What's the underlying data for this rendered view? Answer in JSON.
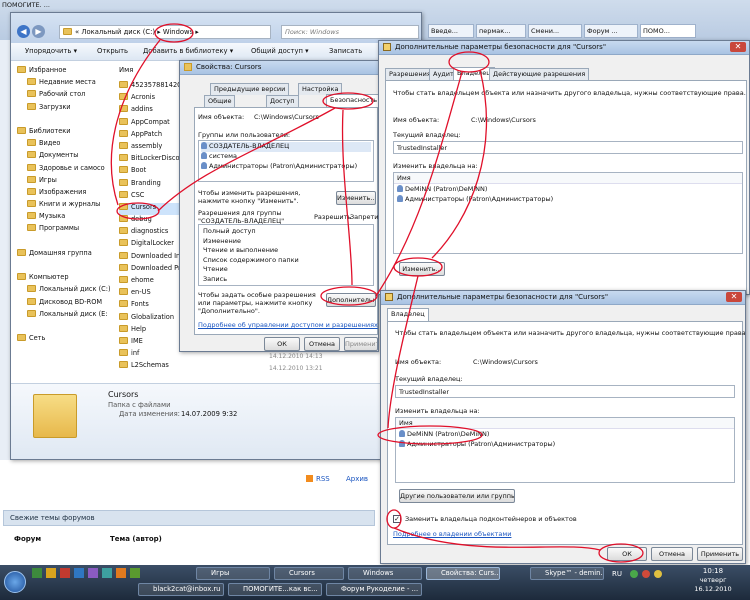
{
  "browser": {
    "tabs": [
      "ПОМОГИТЕ. ...",
      "Введе...",
      "пермак...",
      "Смени...",
      "Форум ...",
      "ПОМО..."
    ]
  },
  "explorer": {
    "address": [
      "Локальный диск (C:)",
      "Windows"
    ],
    "search_placeholder": "Поиск: Windows",
    "toolbar": [
      "Упорядочить ▾",
      "Открыть",
      "Добавить в библиотеку ▾",
      "Общий доступ ▾",
      "Записать"
    ],
    "nav": [
      {
        "label": "Избранное",
        "indent": 0
      },
      {
        "label": "Недавние места",
        "indent": 1
      },
      {
        "label": "Рабочий стол",
        "indent": 1
      },
      {
        "label": "Загрузки",
        "indent": 1
      },
      {
        "label": "",
        "indent": 0
      },
      {
        "label": "Библиотеки",
        "indent": 0
      },
      {
        "label": "Видео",
        "indent": 1
      },
      {
        "label": "Документы",
        "indent": 1
      },
      {
        "label": "Здоровье и самосо",
        "indent": 1
      },
      {
        "label": "Игры",
        "indent": 1
      },
      {
        "label": "Изображения",
        "indent": 1
      },
      {
        "label": "Книги и журналы",
        "indent": 1
      },
      {
        "label": "Музыка",
        "indent": 1
      },
      {
        "label": "Программы",
        "indent": 1
      },
      {
        "label": "",
        "indent": 0
      },
      {
        "label": "Домашняя группа",
        "indent": 0
      },
      {
        "label": "",
        "indent": 0
      },
      {
        "label": "Компьютер",
        "indent": 0
      },
      {
        "label": "Локальный диск (C:)",
        "indent": 1
      },
      {
        "label": "Дисковод BD-ROM",
        "indent": 1
      },
      {
        "label": "Локальный диск (E:",
        "indent": 1
      },
      {
        "label": "",
        "indent": 0
      },
      {
        "label": "Сеть",
        "indent": 0
      }
    ],
    "column_name": "Имя",
    "files": [
      "45235788142C4",
      "Acronis",
      "addins",
      "AppCompat",
      "AppPatch",
      "assembly",
      "BitLockerDiscov",
      "Boot",
      "Branding",
      "CSC",
      "Cursors",
      "debug",
      "diagnostics",
      "DigitalLocker",
      "Downloaded Inst",
      "Downloaded Pro",
      "ehome",
      "en-US",
      "Fonts",
      "Globalization",
      "Help",
      "IME",
      "inf",
      "L2Schemas"
    ],
    "details": {
      "name": "Cursors",
      "type": "Папка с файлами",
      "date_label": "Дата изменения:",
      "date_value": "14.07.2009 9:32"
    },
    "dates": [
      "14.12.2010 14:13",
      "14.12.2010 13:21"
    ]
  },
  "props": {
    "title": "Свойства: Cursors",
    "tabs_row1": [
      "Предыдущие версии",
      "Настройка"
    ],
    "tabs_row2": [
      "Общие",
      "Доступ",
      "Безопасность"
    ],
    "object_label": "Имя объекта:",
    "object_value": "C:\\Windows\\Cursors",
    "groups_label": "Группы или пользователи:",
    "groups": [
      "СОЗДАТЕЛЬ-ВЛАДЕЛЕЦ",
      "система",
      "Администраторы (Patron\\Администраторы)"
    ],
    "change_hint": "Чтобы изменить разрешения, нажмите кнопку \"Изменить\".",
    "change_btn": "Изменить...",
    "perm_for": "Разрешения для группы \"СОЗДАТЕЛЬ-ВЛАДЕЛЕЦ\"",
    "perm_allow": "Разрешить",
    "perm_deny": "Запрети",
    "perms": [
      "Полный доступ",
      "Изменение",
      "Чтение и выполнение",
      "Список содержимого папки",
      "Чтение",
      "Запись"
    ],
    "special_hint": "Чтобы задать особые разрешения или параметры, нажмите кнопку \"Дополнительно\".",
    "advanced_btn": "Дополнительно",
    "link": "Подробнее об управлении доступом и разрешениях",
    "ok": "ОК",
    "cancel": "Отмена",
    "apply": "Применить"
  },
  "adv1": {
    "title": "Дополнительные параметры безопасности  для \"Cursors\"",
    "tabs": [
      "Разрешения",
      "Аудит",
      "Владелец",
      "Действующие разрешения"
    ],
    "intro": "Чтобы стать владельцем объекта или назначить другого владельца, нужны соответствующие права.",
    "object_label": "Имя объекта:",
    "object_value": "C:\\Windows\\Cursors",
    "owner_label": "Текущий владелец:",
    "owner_value": "TrustedInstaller",
    "change_to": "Изменить владельца на:",
    "col_name": "Имя",
    "owners": [
      "DeMiNN (Patron\\DeMiNN)",
      "Администраторы (Patron\\Администраторы)"
    ],
    "change_btn": "Изменить..."
  },
  "adv2": {
    "title": "Дополнительные параметры безопасности  для \"Cursors\"",
    "tab": "Владелец",
    "intro": "Чтобы стать владельцем объекта или назначить другого владельца, нужны соответствующие права.",
    "object_label": "Имя объекта:",
    "object_value": "C:\\Windows\\Cursors",
    "owner_label": "Текущий владелец:",
    "owner_value": "TrustedInstaller",
    "change_to": "Изменить владельца на:",
    "col_name": "Имя",
    "owners": [
      "DeMiNN (Patron\\DeMiNN)",
      "Администраторы (Patron\\Администраторы)"
    ],
    "other_btn": "Другие пользователи или группы...",
    "checkbox": "Заменить владельца подконтейнеров и объектов",
    "link": "Подробнее о владении объектами",
    "ok": "ОК",
    "cancel": "Отмена",
    "apply": "Применить"
  },
  "forum": {
    "rss": "RSS",
    "archive": "Архив",
    "heading": "Свежие темы форумов",
    "col_forum": "Форум",
    "col_topic": "Тема (автор)"
  },
  "taskbar": {
    "row1": [
      "Игры",
      "Cursors",
      "Windows",
      "Свойства: Curs...",
      "Skype™ - demin..."
    ],
    "row2": [
      "black2cat@inbox.ru",
      "ПОМОГИТЕ...как вс...",
      "Форум Рукоделие - ..."
    ],
    "lang": "RU",
    "time": "10:18",
    "day": "четверг",
    "date": "16.12.2010"
  },
  "colors": {
    "annotation": "#e0102a",
    "accent": "#1a55c0"
  }
}
